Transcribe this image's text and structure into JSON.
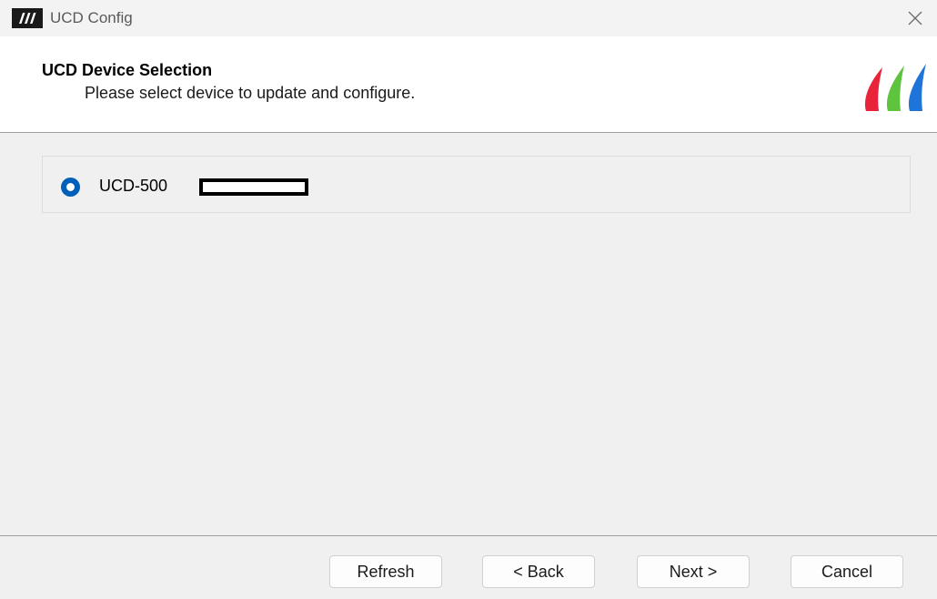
{
  "window": {
    "title": "UCD Config",
    "close_icon": "close-icon",
    "app_icon": "ucd-logo-icon"
  },
  "header": {
    "title": "UCD Device Selection",
    "subtitle": "Please select device to update and configure.",
    "logo_colors": [
      "#e8233a",
      "#5ec33d",
      "#1f74d9"
    ]
  },
  "devices": [
    {
      "label": "UCD-500",
      "selected": true,
      "serial_redacted": true
    }
  ],
  "buttons": {
    "refresh": "Refresh",
    "back": "< Back",
    "next": "Next >",
    "cancel": "Cancel"
  },
  "colors": {
    "accent": "#005fb8",
    "background": "#f0f0f0",
    "header_bg": "#ffffff"
  }
}
